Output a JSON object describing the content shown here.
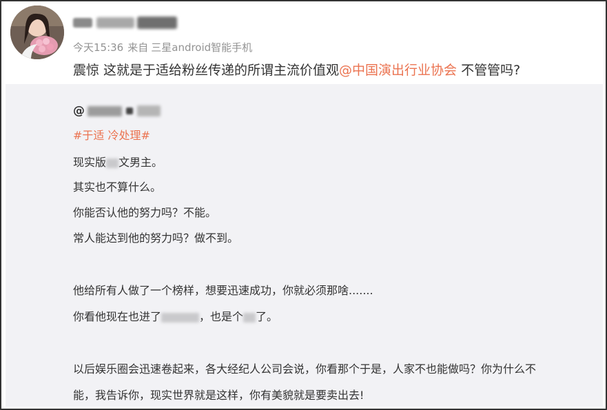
{
  "post": {
    "time": "今天15:36",
    "source_prefix": "来自",
    "source": "三星android智能手机",
    "text_before": "震惊 这就是于适给粉丝传递的所谓主流价值观",
    "mention": "@中国演出行业协会",
    "text_after": " 不管管吗?"
  },
  "quote": {
    "at_sign": "@",
    "topic": "#于适 冷处理#",
    "line1_a": "现实版",
    "line1_b": "文男主。",
    "line2": "其实也不算什么。",
    "line3": "你能否认他的努力吗？不能。",
    "line4": "常人能达到他的努力吗？做不到。",
    "line5": "他给所有人做了一个榜样，想要迅速成功，你就必须那啥.......",
    "line6_a": "你看他现在也进了",
    "line6_b": "，也是个",
    "line6_c": "了。",
    "line7": "以后娱乐圈会迅速卷起来，各大经纪人公司会说，你看那个于是，人家不也能做吗？你为什么不",
    "line8": "能，我告诉你，现实世界就是这样，你有美貌就是要卖出去!"
  },
  "colors": {
    "accent": "#eb7350",
    "meta": "#939393",
    "quote_bg": "#f2f2f5"
  }
}
